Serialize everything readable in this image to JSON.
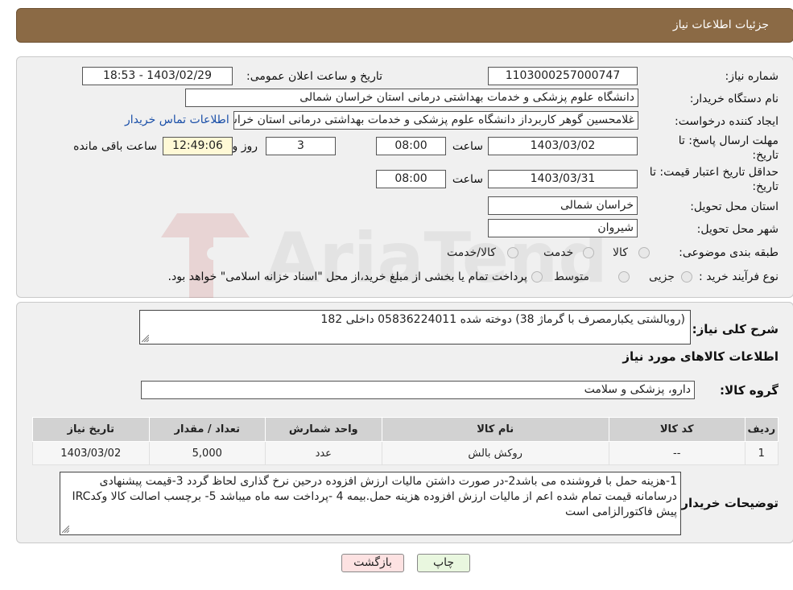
{
  "header": {
    "title": "جزئیات اطلاعات نیاز"
  },
  "form": {
    "need_number_label": "شماره نیاز:",
    "need_number": "1103000257000747",
    "announce_label": "تاریخ و ساعت اعلان عمومی:",
    "announce_value": "1403/02/29 - 18:53",
    "buyer_org_label": "نام دستگاه خریدار:",
    "buyer_org": "دانشگاه علوم پزشکی و خدمات بهداشتی درمانی استان خراسان شمالی",
    "requester_label": "ایجاد کننده درخواست:",
    "requester": "غلامحسین گوهر کاربرداز  دانشگاه علوم پزشکی و خدمات بهداشتی درمانی استان خراسان شمالی",
    "contact_link": "اطلاعات تماس خریدار",
    "deadline_label_1": "مهلت ارسال پاسخ: تا",
    "deadline_label_2": "تاریخ:",
    "deadline_date": "1403/03/02",
    "time_label": "ساعت",
    "deadline_time": "08:00",
    "days_value": "3",
    "days_label": "روز و",
    "remaining_time": "12:49:06",
    "remaining_label": "ساعت باقی مانده",
    "validity_label_1": "حداقل تاریخ اعتبار قیمت: تا",
    "validity_label_2": "تاریخ:",
    "validity_date": "1403/03/31",
    "validity_time_label": "ساعت",
    "validity_time": "08:00",
    "province_label": "استان محل تحویل:",
    "province": "خراسان شمالی",
    "city_label": "شهر محل تحویل:",
    "city": "شیروان",
    "category_label": "طبقه بندی موضوعی:",
    "category_options": [
      "کالا",
      "خدمت",
      "کالا/خدمت"
    ],
    "process_label": "نوع فرآیند خرید :",
    "process_options": [
      "جزیی",
      "متوسط"
    ],
    "process_note": "پرداخت تمام یا بخشی از مبلغ خرید،از محل \"اسناد خزانه اسلامی\" خواهد بود."
  },
  "details": {
    "summary_label": "شرح کلی نیاز:",
    "summary": "(روبالشتی یکبارمصرف با گرماژ 38)  دوخته شده  05836224011 داخلی 182",
    "goods_info_title": "اطلاعات کالاهای مورد نیاز",
    "goods_group_label": "گروه کالا:",
    "goods_group": "دارو، پزشکی و سلامت",
    "table": {
      "headers": [
        "ردیف",
        "کد کالا",
        "نام کالا",
        "واحد شمارش",
        "تعداد / مقدار",
        "تاریخ نیاز"
      ],
      "rows": [
        [
          "1",
          "--",
          "روکش بالش",
          "عدد",
          "5,000",
          "1403/03/02"
        ]
      ]
    },
    "buyer_notes_label": "توضیحات خریدار:",
    "buyer_notes": "1-هزینه حمل با فروشنده می باشد2-در صورت داشتن مالیات ارزش افزوده درحین نرخ گذاری لحاظ گردد 3-قیمت پیشنهادی درسامانه  قیمت تمام شده اعم از مالیات ارزش افزوده هزینه حمل.بیمه  4 -پرداخت سه ماه میباشد 5- برچسب اصالت کالا وکدIRC پیش فاکتورالزامی است"
  },
  "buttons": {
    "print": "چاپ",
    "back": "بازگشت"
  },
  "colors": {
    "header_bg": "#8b6a45",
    "back_button_bg": "#fde2e2",
    "print_button_bg": "#e9f7df",
    "link": "#1a4fa8"
  }
}
